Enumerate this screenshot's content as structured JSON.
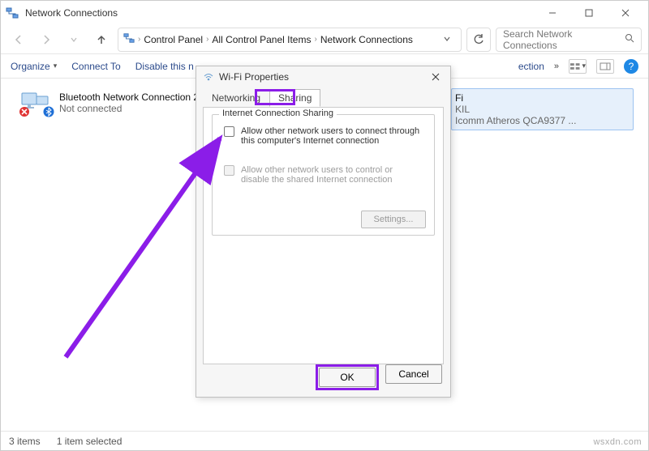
{
  "titlebar": {
    "title": "Network Connections"
  },
  "breadcrumb": {
    "items": [
      "Control Panel",
      "All Control Panel Items",
      "Network Connections"
    ]
  },
  "search": {
    "placeholder": "Search Network Connections"
  },
  "toolbar": {
    "organize": "Organize",
    "connect_to": "Connect To",
    "disable": "Disable this n",
    "overflow_label": "ection"
  },
  "connections": [
    {
      "name": "Bluetooth Network Connection 2",
      "status": "Not connected",
      "selected": false,
      "error": true,
      "bt": true
    },
    {
      "name": "Fi",
      "status": "KIL",
      "detail": "Icomm Atheros QCA9377 ...",
      "selected": true,
      "error": false,
      "bt": false
    }
  ],
  "statusbar": {
    "count": "3 items",
    "selection": "1 item selected"
  },
  "dialog": {
    "title": "Wi-Fi Properties",
    "tabs": {
      "networking": "Networking",
      "sharing": "Sharing"
    },
    "group": {
      "legend": "Internet Connection Sharing",
      "opt1": "Allow other network users to connect through this computer's Internet connection",
      "opt2": "Allow other network users to control or disable the shared Internet connection",
      "settings": "Settings..."
    },
    "buttons": {
      "ok": "OK",
      "cancel": "Cancel"
    }
  },
  "watermark": "wsxdn.com"
}
